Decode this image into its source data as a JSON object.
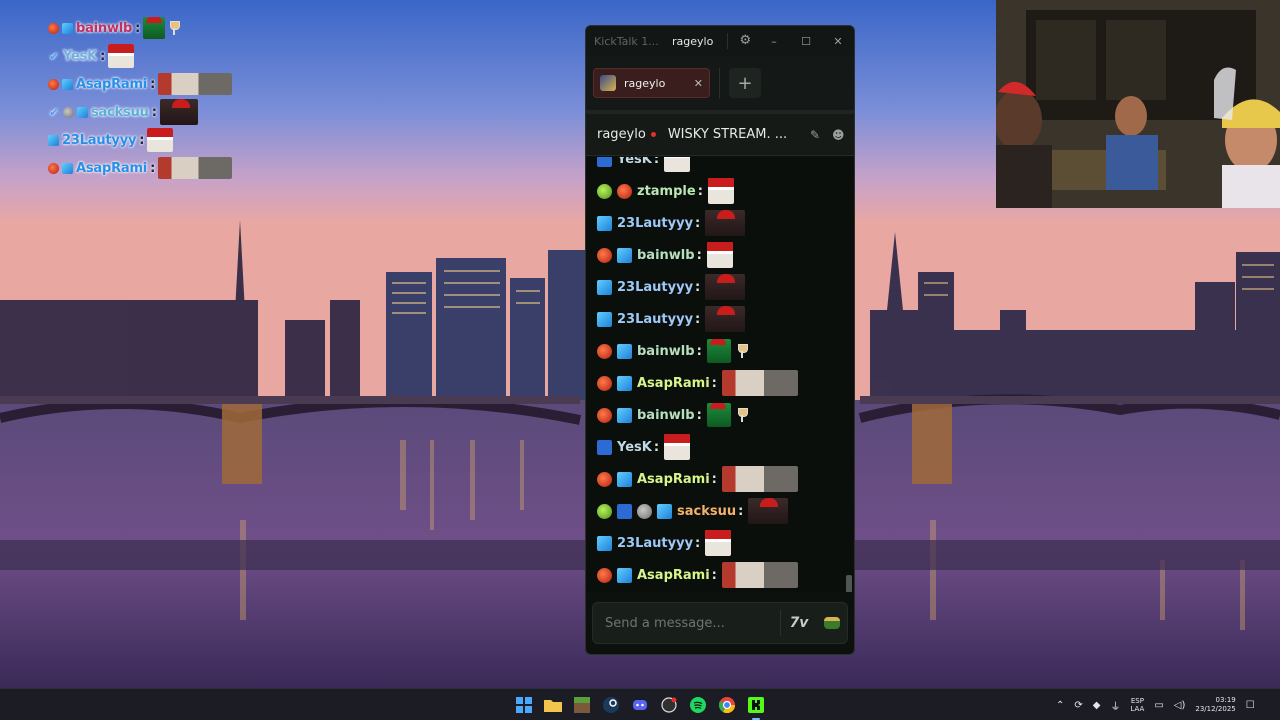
{
  "overlay_chat": [
    {
      "user": "bainwlb",
      "color": "#c03060",
      "badges": [
        "red",
        "cube"
      ],
      "emotes": [
        "green",
        "glass"
      ]
    },
    {
      "user": "YesK",
      "color": "#6fb0e0",
      "badges": [
        "check"
      ],
      "emotes": [
        "santa"
      ]
    },
    {
      "user": "AsapRami",
      "color": "#2a8fe8",
      "badges": [
        "red",
        "cube"
      ],
      "emotes": [
        "wide"
      ]
    },
    {
      "user": "sacksuu",
      "color": "#5bb0d8",
      "badges": [
        "check",
        "grey",
        "cube"
      ],
      "emotes": [
        "hat"
      ]
    },
    {
      "user": "23Lautyyy",
      "color": "#2a8fe8",
      "badges": [
        "cube"
      ],
      "emotes": [
        "santa"
      ]
    },
    {
      "user": "AsapRami",
      "color": "#2a8fe8",
      "badges": [
        "red",
        "cube"
      ],
      "emotes": [
        "wide"
      ]
    }
  ],
  "window": {
    "app_title": "KickTalk 1....",
    "user_button": "rageylo",
    "settings_icon": "gear-icon",
    "controls": {
      "minimize": "–",
      "maximize": "☐",
      "close": "✕"
    }
  },
  "tabs": [
    {
      "label": "rageylo",
      "close": "✕"
    }
  ],
  "add_tab_label": "+",
  "chat_header": {
    "streamer": "rageylo",
    "stream_title": "WISKY STREAM. ...",
    "live": true
  },
  "messages": [
    {
      "user": "YesK",
      "color": "#c1d9e3",
      "badges": [
        "sword"
      ],
      "emotes": [
        "santa"
      ],
      "partial": true
    },
    {
      "user": "ztample",
      "color": "#b9e7b5",
      "badges": [
        "bot",
        "red"
      ],
      "emotes": [
        "santa"
      ]
    },
    {
      "user": "23Lautyyy",
      "color": "#9fc9f5",
      "badges": [
        "cube"
      ],
      "emotes": [
        "hat"
      ]
    },
    {
      "user": "bainwlb",
      "color": "#b5e0c0",
      "badges": [
        "red",
        "cube"
      ],
      "emotes": [
        "santa"
      ]
    },
    {
      "user": "23Lautyyy",
      "color": "#9fc9f5",
      "badges": [
        "cube"
      ],
      "emotes": [
        "hat"
      ]
    },
    {
      "user": "23Lautyyy",
      "color": "#9fc9f5",
      "badges": [
        "cube"
      ],
      "emotes": [
        "hat"
      ]
    },
    {
      "user": "bainwlb",
      "color": "#b5e0c0",
      "badges": [
        "red",
        "cube"
      ],
      "emotes": [
        "green",
        "glass"
      ]
    },
    {
      "user": "AsapRami",
      "color": "#d6f58a",
      "badges": [
        "red",
        "cube"
      ],
      "emotes": [
        "wide"
      ]
    },
    {
      "user": "bainwlb",
      "color": "#b5e0c0",
      "badges": [
        "red",
        "cube"
      ],
      "emotes": [
        "green",
        "glass"
      ]
    },
    {
      "user": "YesK",
      "color": "#c1d9e3",
      "badges": [
        "sword"
      ],
      "emotes": [
        "santa"
      ]
    },
    {
      "user": "AsapRami",
      "color": "#d6f58a",
      "badges": [
        "red",
        "cube"
      ],
      "emotes": [
        "wide"
      ]
    },
    {
      "user": "sacksuu",
      "color": "#f5b06a",
      "badges": [
        "bot",
        "sword",
        "grey",
        "cube"
      ],
      "emotes": [
        "hat"
      ]
    },
    {
      "user": "23Lautyyy",
      "color": "#9fc9f5",
      "badges": [
        "cube"
      ],
      "emotes": [
        "santa"
      ]
    },
    {
      "user": "AsapRami",
      "color": "#d6f58a",
      "badges": [
        "red",
        "cube"
      ],
      "emotes": [
        "wide"
      ]
    }
  ],
  "input": {
    "placeholder": "Send a message...",
    "seventv_label": "7v",
    "emoji_icon": "kick-emote-icon"
  },
  "taskbar": {
    "apps": [
      "windows-start-icon",
      "file-explorer-icon",
      "minecraft-icon",
      "steam-icon",
      "discord-icon",
      "obs-icon",
      "spotify-icon",
      "chrome-icon",
      "kick-icon"
    ],
    "language_top": "ESP",
    "language_bottom": "LAA",
    "time": "03:19",
    "date": "23/12/2025"
  },
  "colors": {
    "window_bg": "#0d110e",
    "tab_active": "#3a1d1d",
    "live_dot": "#e03030",
    "kick_green": "#53fc18"
  }
}
